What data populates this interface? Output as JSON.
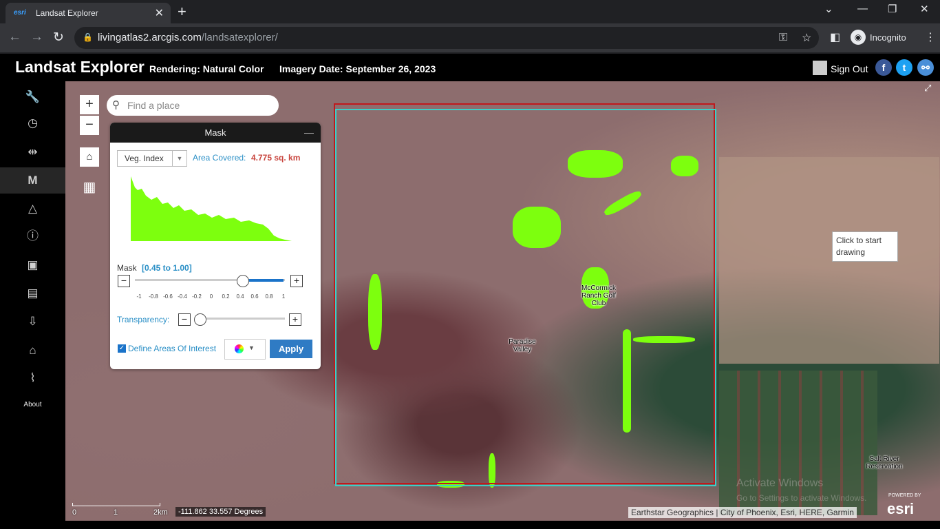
{
  "browser": {
    "tab_title": "Landsat Explorer",
    "tab_favicon": "esri",
    "url_domain": "livingatlas2.arcgis.com",
    "url_path": "/landsatexplorer/",
    "incognito_label": "Incognito"
  },
  "header": {
    "title": "Landsat Explorer",
    "rendering": "Rendering: Natural Color",
    "imagery_date": "Imagery Date: September 26, 2023",
    "sign_out": "Sign Out"
  },
  "sidebar": {
    "items": [
      {
        "name": "wrench-icon",
        "glyph": "🔧"
      },
      {
        "name": "clock-icon",
        "glyph": "🕓"
      },
      {
        "name": "swipe-icon",
        "glyph": "⇹"
      },
      {
        "name": "mask-icon",
        "glyph": "M"
      },
      {
        "name": "triangle-icon",
        "glyph": "△"
      },
      {
        "name": "info-icon",
        "glyph": "ℹ"
      },
      {
        "name": "book-icon",
        "glyph": "▣"
      },
      {
        "name": "save-icon",
        "glyph": "▤"
      },
      {
        "name": "download-icon",
        "glyph": "⇩"
      },
      {
        "name": "graduation-cap-icon",
        "glyph": "🎓"
      },
      {
        "name": "story-icon",
        "glyph": "⌇"
      }
    ],
    "about": "About"
  },
  "map": {
    "search_placeholder": "Find a place",
    "tooltip": "Click to start drawing",
    "place_paradise": "Paradise Valley",
    "place_mccormick": "McCormick Ranch Golf Club",
    "place_salt_river": "Salt River Reservation",
    "scale": [
      "0",
      "1",
      "2km"
    ],
    "coordinates": "-111.862 33.557 Degrees",
    "attribution": "Earthstar Geographics | City of Phoenix, Esri, HERE, Garmin",
    "watermark_title": "Activate Windows",
    "watermark_sub": "Go to Settings to activate Windows.",
    "esri_powered": "POWERED BY",
    "esri": "esri"
  },
  "mask_panel": {
    "title": "Mask",
    "index_select": "Veg. Index",
    "area_label": "Area Covered:",
    "area_value": "4.775 sq. km",
    "mask_label": "Mask",
    "mask_range": "[0.45 to 1.00]",
    "mask_min": 0.45,
    "mask_max": 1.0,
    "ticks": [
      "-1",
      "-0.8",
      "-0.6",
      "-0.4",
      "-0.2",
      "0",
      "0.2",
      "0.4",
      "0.6",
      "0.8",
      "1"
    ],
    "transparency_label": "Transparency:",
    "transparency_value": 0,
    "define_aoi": "Define Areas Of Interest",
    "apply": "Apply"
  },
  "colors": {
    "mask_green": "#7dff0e",
    "aoi_red": "#c0191d",
    "aoi_cyan": "#3ccfc7",
    "accent": "#2a8fc6"
  }
}
